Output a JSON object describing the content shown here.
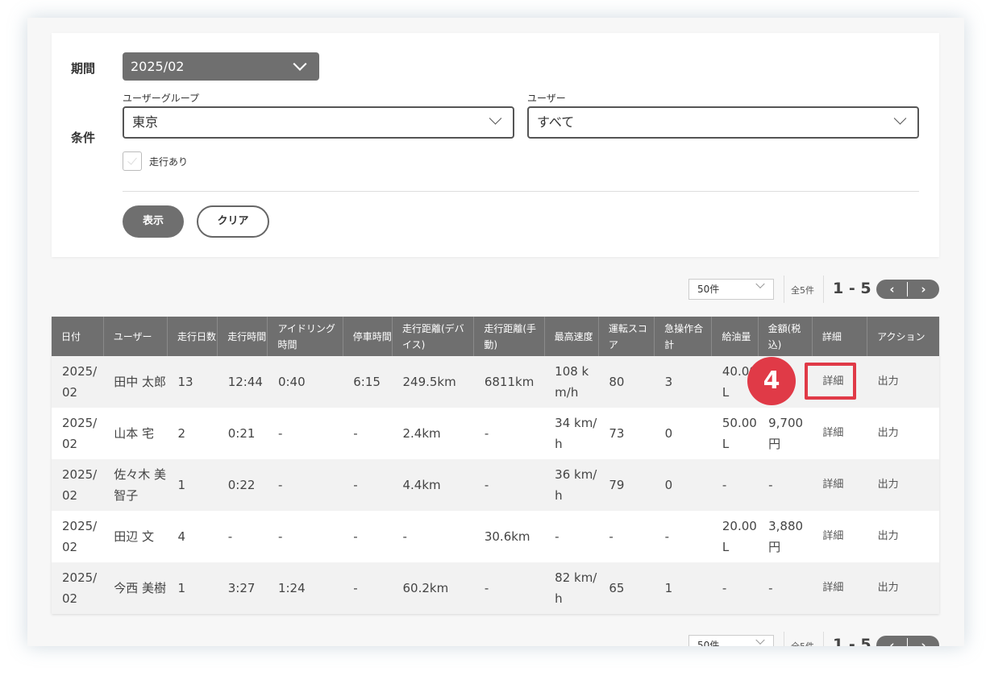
{
  "filters": {
    "period_label": "期間",
    "period_value": "2025/02",
    "condition_label": "条件",
    "group_label": "ユーザーグループ",
    "group_value": "東京",
    "user_label": "ユーザー",
    "user_value": "すべて",
    "running_checkbox_label": "走行あり",
    "running_checked": false,
    "show_button": "表示",
    "clear_button": "クリア"
  },
  "pagination": {
    "per_page": "50件",
    "total": "全5件",
    "range": "1 - 5",
    "prev_icon": "‹",
    "next_icon": "›"
  },
  "table": {
    "headers": [
      "日付",
      "ユーザー",
      "走行日数",
      "走行時間",
      "アイドリング時間",
      "停車時間",
      "走行距離(デバイス)",
      "走行距離(手動)",
      "最高速度",
      "運転スコア",
      "急操作合計",
      "給油量",
      "金額(税込)",
      "詳細",
      "アクション"
    ],
    "rows": [
      [
        "2025/02",
        "田中 太郎",
        "13",
        "12:44",
        "0:40",
        "6:15",
        "249.5km",
        "6811km",
        "108 km/h",
        "80",
        "3",
        "40.00L",
        "",
        "詳細",
        "出力"
      ],
      [
        "2025/02",
        "山本 宅",
        "2",
        "0:21",
        "-",
        "-",
        "2.4km",
        "-",
        "34 km/h",
        "73",
        "0",
        "50.00L",
        "9,700円",
        "詳細",
        "出力"
      ],
      [
        "2025/02",
        "佐々木 美智子",
        "1",
        "0:22",
        "-",
        "-",
        "4.4km",
        "-",
        "36 km/h",
        "79",
        "0",
        "-",
        "-",
        "詳細",
        "出力"
      ],
      [
        "2025/02",
        "田辺 文",
        "4",
        "-",
        "-",
        "-",
        "-",
        "30.6km",
        "-",
        "-",
        "-",
        "20.00L",
        "3,880円",
        "詳細",
        "出力"
      ],
      [
        "2025/02",
        "今西 美樹",
        "1",
        "3:27",
        "1:24",
        "-",
        "60.2km",
        "-",
        "82 km/h",
        "65",
        "1",
        "-",
        "-",
        "詳細",
        "出力"
      ]
    ]
  },
  "annotation": {
    "step_number": "4",
    "highlight_color": "#e03a47"
  }
}
